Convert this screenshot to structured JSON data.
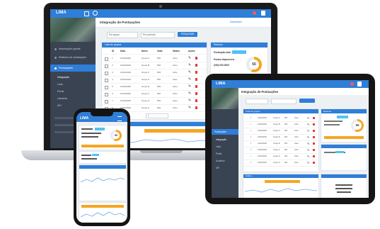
{
  "brand": {
    "logo": "LIMA",
    "accent": "#2f7ed8",
    "sidebar_bg": "#3a4352",
    "warning": "#f5a623"
  },
  "laptop": {
    "page_title": "Integração de Pontuações",
    "breadcrumb": "Dashboard",
    "filters": {
      "project": "Por grupo",
      "period": "Por período",
      "search_btn": "PESQUISAR"
    },
    "sidebar": [
      "Informações gerais",
      "Relatório de solicitações",
      "Pontuações",
      "Integração",
      "Lista",
      "Perfis",
      "Usuários",
      "API"
    ],
    "table_card_title": "Lista de grupos",
    "table_headers": [
      "ID",
      "Data",
      "Nome",
      "Valor",
      "Status",
      "Ações"
    ],
    "table_rows": [
      [
        "1",
        "10/04/2020",
        "Grupo A",
        "500",
        "Ativo"
      ],
      [
        "2",
        "10/04/2020",
        "Grupo B",
        "500",
        "Ativo"
      ],
      [
        "3",
        "10/04/2020",
        "Grupo C",
        "500",
        "Ativo"
      ],
      [
        "4",
        "10/04/2020",
        "Grupo D",
        "500",
        "Ativo"
      ],
      [
        "5",
        "10/04/2020",
        "Grupo E",
        "500",
        "Ativo"
      ],
      [
        "6",
        "10/04/2020",
        "Grupo F",
        "500",
        "Ativo"
      ],
      [
        "7",
        "10/04/2020",
        "Grupo G",
        "500",
        "Ativo"
      ],
      [
        "8",
        "10/04/2020",
        "Grupo H",
        "500",
        "Ativo"
      ]
    ],
    "pagination": "1",
    "summary_title": "Resumo",
    "summary_lines": [
      "Pontuação total",
      "Pontos disponíveis",
      "(000) 000-0000"
    ],
    "donut_value": "56",
    "donut_pct": 0.56,
    "chart_card_title": "Gráfico"
  },
  "tablet": {
    "page_title": "Integração de Pontuações",
    "sidebar": [
      "Pontuações",
      "Integração",
      "Lista",
      "Perfis",
      "Usuários",
      "API"
    ],
    "table_card_title": "Lista de grupos",
    "summary_title": "Resumo",
    "donut_value": "56",
    "chart_card_title": "Gráfico",
    "bottom_card_title": "Info",
    "bottom_text": "Grupos: 2.0\n(000) 000-0000"
  },
  "phone": {
    "logo": "LIMA",
    "card_title": "Resumo",
    "donut_value": "56",
    "chart_title": "Gráfico"
  }
}
